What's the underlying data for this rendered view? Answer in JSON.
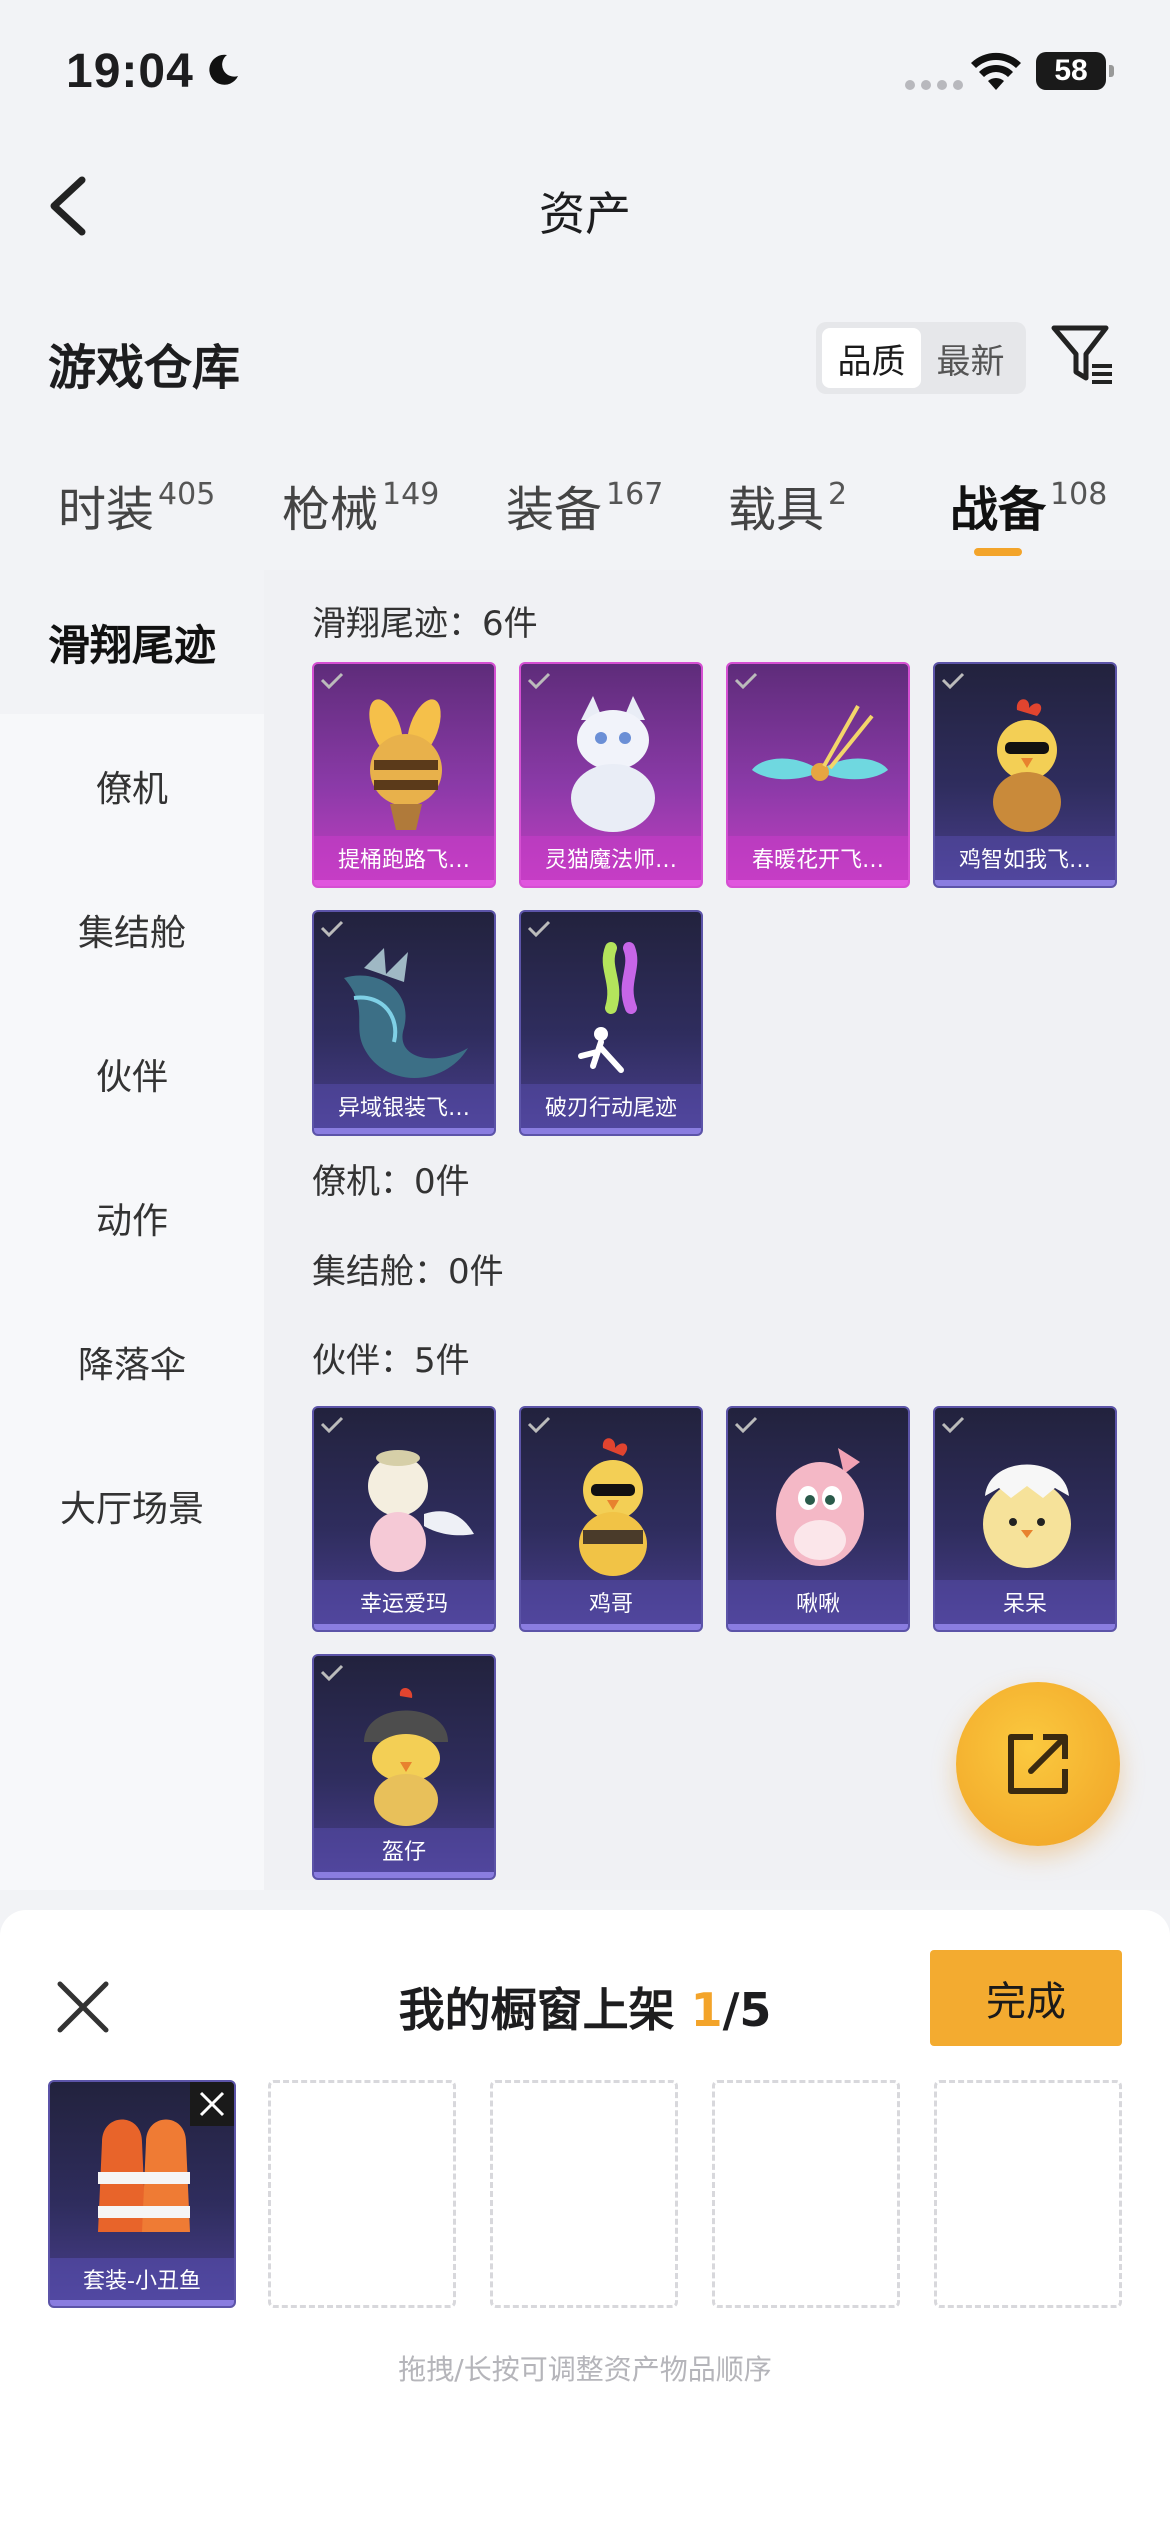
{
  "status_bar": {
    "time": "19:04",
    "battery": "58"
  },
  "nav": {
    "title": "资产"
  },
  "header": {
    "title": "游戏仓库",
    "sort_options": [
      "品质",
      "最新"
    ],
    "sort_selected": "品质"
  },
  "tabs": [
    {
      "label": "时装",
      "count": "405"
    },
    {
      "label": "枪械",
      "count": "149"
    },
    {
      "label": "装备",
      "count": "167"
    },
    {
      "label": "载具",
      "count": "2"
    },
    {
      "label": "战备",
      "count": "108"
    }
  ],
  "active_tab": "战备",
  "sidebar": {
    "items": [
      "滑翔尾迹",
      "僚机",
      "集结舱",
      "伙伴",
      "动作",
      "降落伞",
      "大厅场景"
    ]
  },
  "sections": [
    {
      "title": "滑翔尾迹：6件",
      "items": [
        {
          "name": "提桶跑路飞…",
          "rarity": "purple"
        },
        {
          "name": "灵猫魔法师…",
          "rarity": "purple"
        },
        {
          "name": "春暖花开飞…",
          "rarity": "purple"
        },
        {
          "name": "鸡智如我飞…",
          "rarity": "blue"
        },
        {
          "name": "异域银装飞…",
          "rarity": "blue"
        },
        {
          "name": "破刃行动尾迹",
          "rarity": "blue"
        }
      ]
    },
    {
      "title": "僚机：0件",
      "items": []
    },
    {
      "title": "集结舱：0件",
      "items": []
    },
    {
      "title": "伙伴：5件",
      "items": [
        {
          "name": "幸运爱玛",
          "rarity": "blue"
        },
        {
          "name": "鸡哥",
          "rarity": "blue"
        },
        {
          "name": "啾啾",
          "rarity": "blue"
        },
        {
          "name": "呆呆",
          "rarity": "blue"
        },
        {
          "name": "盔仔",
          "rarity": "blue"
        }
      ]
    }
  ],
  "showcase": {
    "title_prefix": "我的橱窗上架 ",
    "count": "1",
    "total": "/5",
    "done_label": "完成",
    "slots": [
      {
        "name": "套装-小丑鱼"
      }
    ],
    "hint": "拖拽/长按可调整资产物品顺序"
  },
  "colors": {
    "accent": "#f3a42a",
    "purple_rarity": "#c53fc2",
    "blue_rarity": "#4a3f8e"
  }
}
